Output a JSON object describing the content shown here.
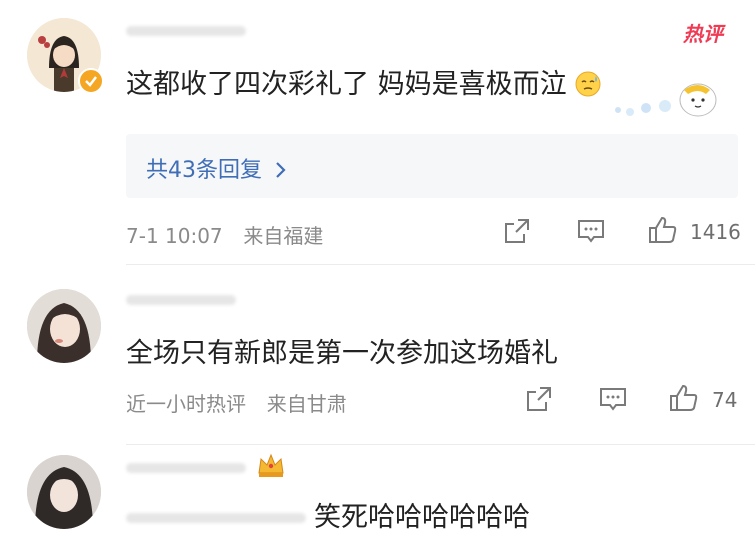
{
  "comments": [
    {
      "username": "",
      "text": "这都收了四次彩礼了 妈妈是喜极而泣",
      "hot_badge": "热评",
      "replies_label": "共43条回复",
      "timestamp": "7-1 10:07",
      "location": "来自福建",
      "like_count": "1416"
    },
    {
      "username": "",
      "text": "全场只有新郎是第一次参加这场婚礼",
      "timestamp": "近一小时热评",
      "location": "来自甘肃",
      "like_count": "74"
    },
    {
      "username": "",
      "text": "笑死哈哈哈哈哈哈"
    }
  ],
  "colors": {
    "link_blue": "#3f6eb6",
    "hot_red": "#f03b55",
    "verified_gold": "#f5a623"
  }
}
